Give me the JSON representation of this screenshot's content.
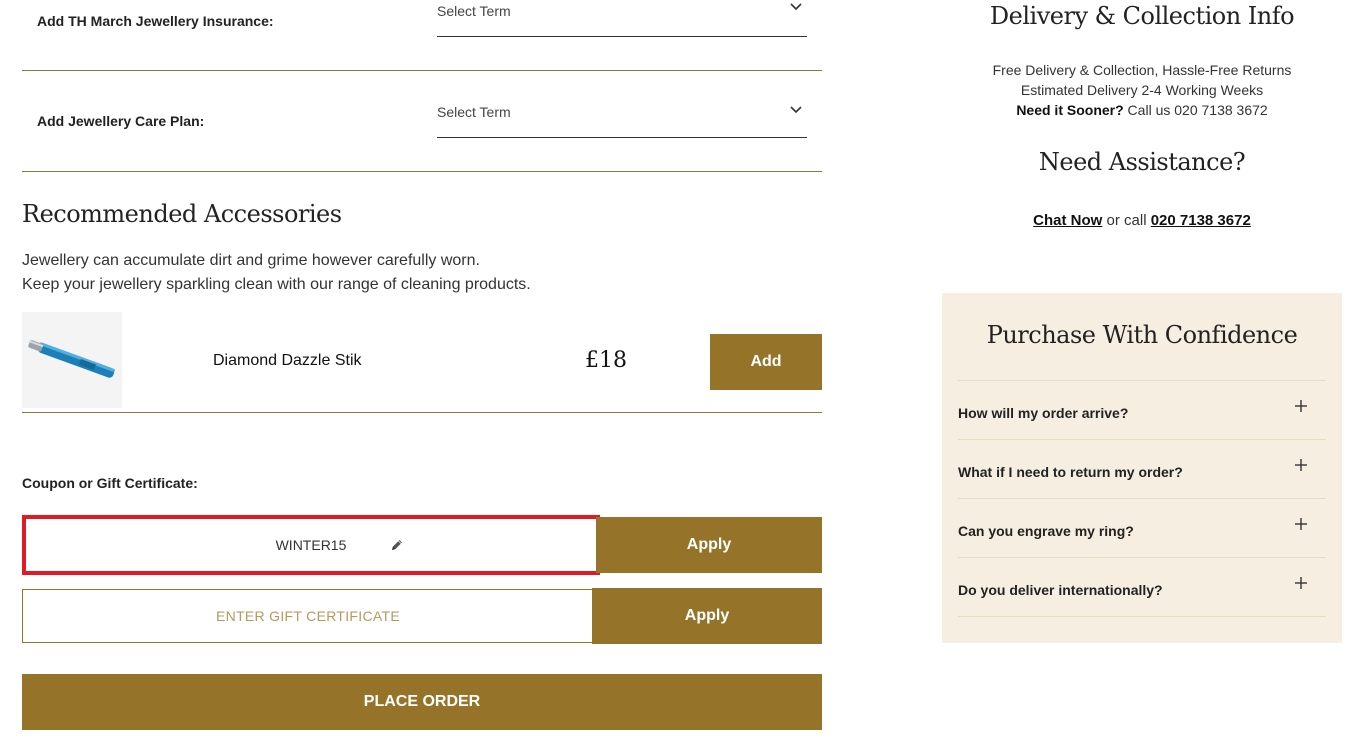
{
  "addons": [
    {
      "label": "Add TH March Jewellery Insurance:",
      "select_value": "Select Term"
    },
    {
      "label": "Add Jewellery Care Plan:",
      "select_value": "Select Term"
    }
  ],
  "accessories": {
    "title": "Recommended Accessories",
    "desc_line1": "Jewellery can accumulate dirt and grime however carefully worn.",
    "desc_line2": "Keep your jewellery sparkling clean with our range of cleaning products.",
    "item": {
      "name": "Diamond Dazzle Stik",
      "price": "£18",
      "add_label": "Add"
    }
  },
  "coupon": {
    "label": "Coupon or Gift Certificate:",
    "coupon_value": "WINTER15",
    "apply_label": "Apply",
    "gift_placeholder": "ENTER GIFT CERTIFICATE",
    "gift_apply_label": "Apply"
  },
  "place_order_label": "PLACE ORDER",
  "delivery": {
    "title": "Delivery & Collection Info",
    "line1": "Free Delivery & Collection, Hassle-Free Returns",
    "line2": "Estimated Delivery 2-4 Working Weeks",
    "line3_bold": "Need it Sooner?",
    "line3_rest": " Call us 020 7138 3672"
  },
  "assistance": {
    "title": "Need Assistance?",
    "chat_label": "Chat Now",
    "middle": " or call ",
    "phone": "020 7138 3672"
  },
  "confidence": {
    "title": "Purchase With Confidence",
    "faqs": [
      {
        "q": "How will my order arrive?"
      },
      {
        "q": "What if I need to return my order?"
      },
      {
        "q": "Can you engrave my ring?"
      },
      {
        "q": "Do you deliver internationally?"
      }
    ]
  },
  "colors": {
    "gold": "#95742a",
    "highlight": "#e01b24",
    "panel": "#f6efe1"
  },
  "icons": {
    "select": "chevron-down-icon",
    "edit": "pencil-icon",
    "expand": "plus-icon"
  }
}
